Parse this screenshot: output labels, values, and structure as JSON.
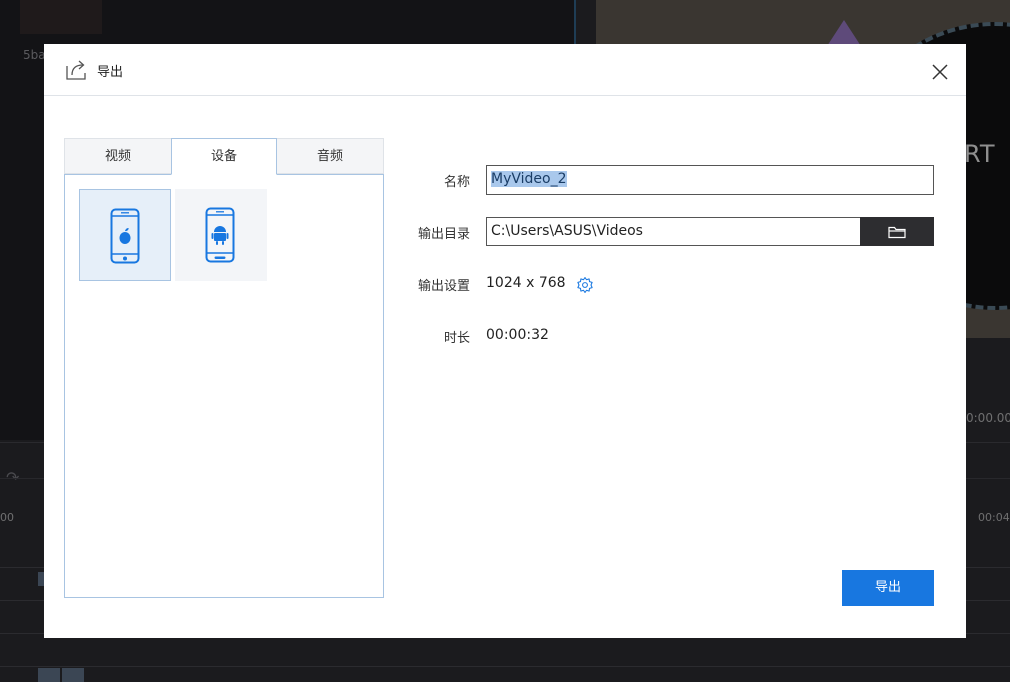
{
  "background": {
    "thumb_label": "5ba",
    "right_text": "RT",
    "right_time": "0:00.00",
    "ruler_left": "00",
    "ruler_right": "00:04"
  },
  "dialog": {
    "title": "导出",
    "tabs": [
      "视频",
      "设备",
      "音频"
    ],
    "active_tab": "设备",
    "devices": [
      {
        "name": "ios",
        "icon": "iphone-apple-icon",
        "selected": true
      },
      {
        "name": "android",
        "icon": "phone-android-icon",
        "selected": false
      }
    ],
    "form": {
      "name_label": "名称",
      "name_value": "MyVideo_2",
      "dir_label": "输出目录",
      "dir_value": "C:\\Users\\ASUS\\Videos",
      "settings_label": "输出设置",
      "settings_value": "1024 x 768",
      "duration_label": "时长",
      "duration_value": "00:00:32"
    },
    "export_button": "导出",
    "colors": {
      "accent": "#1877e0",
      "icon_blue": "#1877e0",
      "selection": "#a9c8ec"
    }
  }
}
